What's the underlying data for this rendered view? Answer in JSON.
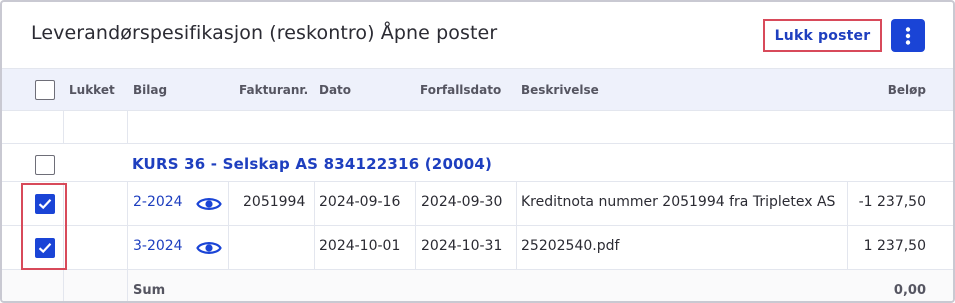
{
  "header": {
    "title": "Leverandørspesifikasjon (reskontro) Åpne poster",
    "close_button_label": "Lukk poster",
    "more_button_icon": "vertical-dots-icon"
  },
  "table": {
    "columns": {
      "lukket": "Lukket",
      "bilag": "Bilag",
      "fakturanr": "Fakturanr.",
      "dato": "Dato",
      "forfallsdato": "Forfallsdato",
      "beskrivelse": "Beskrivelse",
      "belop": "Beløp"
    },
    "group": {
      "title": "KURS 36 - Selskap AS 834122316 (20004)",
      "checked": false
    },
    "rows": [
      {
        "checked": true,
        "bilag": "2-2024",
        "fakturanr": "2051994",
        "dato": "2024-09-16",
        "forfallsdato": "2024-09-30",
        "beskrivelse": "Kreditnota nummer 2051994 fra Tripletex AS",
        "belop": "-1 237,50"
      },
      {
        "checked": true,
        "bilag": "3-2024",
        "fakturanr": "",
        "dato": "2024-10-01",
        "forfallsdato": "2024-10-31",
        "beskrivelse": "25202540.pdf",
        "belop": "1 237,50"
      }
    ],
    "sum": {
      "label": "Sum",
      "value": "0,00"
    }
  },
  "colors": {
    "accent": "#1a44d6",
    "link": "#1e3fbf",
    "highlight": "#d84a5a",
    "header_bg": "#eef1fb"
  }
}
